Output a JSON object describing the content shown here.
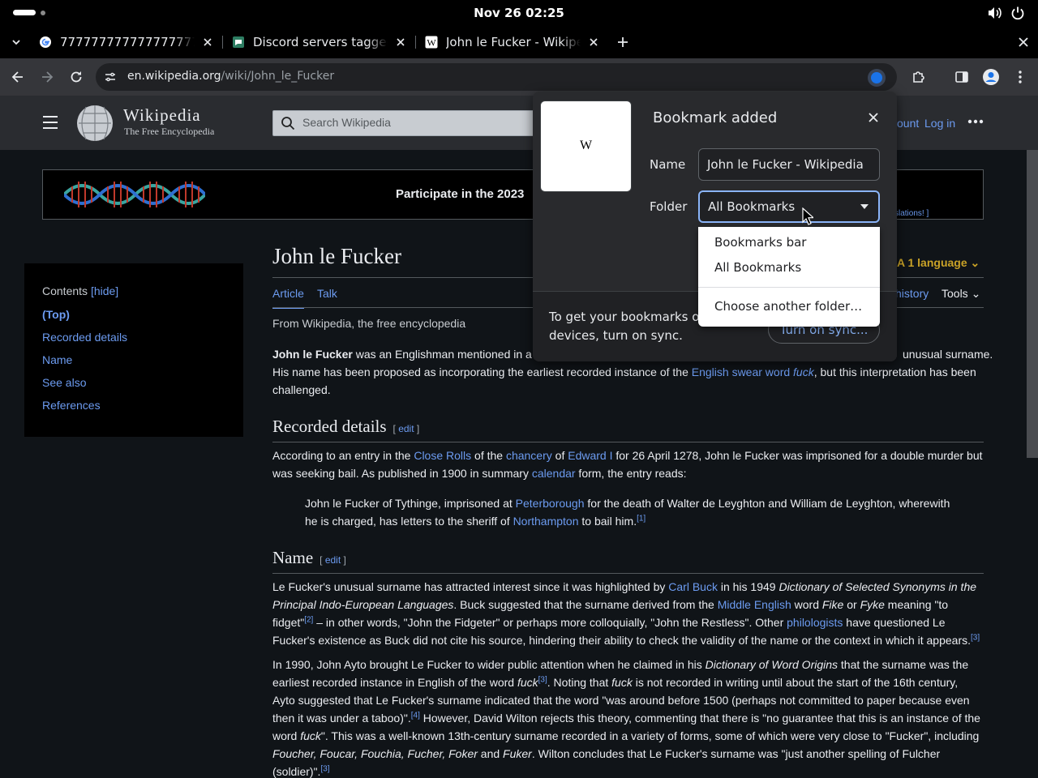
{
  "os": {
    "clock": "Nov 26  02:25",
    "icons": [
      "volume-icon",
      "power-icon"
    ]
  },
  "tabs": [
    {
      "title": "7777777777777777777777",
      "favicon": "google-icon"
    },
    {
      "title": "Discord servers tagged with",
      "favicon": "discord-servers-icon"
    },
    {
      "title": "John le Fucker - Wikipedia",
      "favicon": "wikipedia-icon"
    }
  ],
  "toolbar": {
    "url_host": "en.wikipedia.org",
    "url_path": "/wiki/John_le_Fucker"
  },
  "wiki": {
    "wordmark": "Wikipedia",
    "tagline": "The Free Encyclopedia",
    "search_placeholder": "Search Wikipedia",
    "create_account": "ount",
    "login": "Log in",
    "banner_text": "Participate in the 2023",
    "banner_link": "slations! ]",
    "toc": {
      "title": "Contents",
      "hide": "[hide]",
      "items": [
        "(Top)",
        "Recorded details",
        "Name",
        "See also",
        "References"
      ]
    },
    "article": {
      "title": "John le Fucker",
      "language_btn": "1 language",
      "tab_article": "Article",
      "tab_talk": "Talk",
      "history": "history",
      "tools": "Tools",
      "from": "From Wikipedia, the free encyclopedia",
      "lead_1a": "John le Fucker",
      "lead_1b": " was an Englishman mentioned in a",
      "lead_1c": "unusual surname.",
      "lead_2a": "His name has been proposed as incorporating the earliest recorded instance of the ",
      "lead_2link": "English swear word",
      "lead_2b": "fuck",
      "lead_2c": ", but this interpretation has been",
      "lead_3": "challenged.",
      "sec1_title": "Recorded details",
      "edit": "edit",
      "sec1_p1a": "According to an entry in the ",
      "sec1_close_rolls": "Close Rolls",
      "sec1_p1b": " of the ",
      "sec1_chancery": "chancery",
      "sec1_p1c": " of ",
      "sec1_edward": "Edward I",
      "sec1_p1d": " for 26 April 1278, John le Fucker was imprisoned for a double murder but",
      "sec1_p2a": "was seeking bail. As published in 1900 in summary ",
      "sec1_calendar": "calendar",
      "sec1_p2b": " form, the entry reads:",
      "quote_1a": "John le Fucker of Tythinge, imprisoned at ",
      "quote_peterborough": "Peterborough",
      "quote_1b": " for the death of Walter de Leyghton and William de Leyghton, wherewith",
      "quote_2a": "he is charged, has letters to the sheriff of ",
      "quote_northampton": "Northampton",
      "quote_2b": " to bail him.",
      "ref1": "[1]",
      "sec2_title": "Name",
      "n1a": "Le Fucker's unusual surname has attracted interest since it was highlighted by ",
      "n1_carl": "Carl Buck",
      "n1b": " in his 1949 ",
      "n1_book": "Dictionary of Selected Synonyms in the",
      "n2_book": "Principal Indo-European Languages",
      "n2a": ". Buck suggested that the surname derived from the ",
      "n2_middle": "Middle English",
      "n2b": " word ",
      "n2_fike": "Fike",
      "n2c": " or ",
      "n2_fyke": "Fyke",
      "n2d": " meaning \"to",
      "n3a": "fidget\"",
      "ref2": "[2]",
      "n3b": " – in other words, \"John the Fidgeter\" or perhaps more colloquially, \"John the Restless\". Other ",
      "n3_phil": "philologists",
      "n3c": " have questioned Le",
      "n4": "Fucker's existence as Buck did not cite his source, hindering their ability to check the validity of the name or the context in which it appears.",
      "ref3": "[3]",
      "a1a": "In 1990, John Ayto brought Le Fucker to wider public attention when he claimed in his ",
      "a1_book": "Dictionary of Word Origins",
      "a1b": " that the surname was the",
      "a2a": "earliest recorded instance in English of the word ",
      "a2_fuck": "fuck",
      "a2b": ". Noting that ",
      "a2c": " is not recorded in writing until about the start of the 16th century,",
      "a3": "Ayto suggested that Le Fucker's surname indicated that the word \"was around before 1500 (perhaps not committed to paper because even",
      "a4a": "then it was under a taboo)\".",
      "ref4": "[4]",
      "a4b": " However, David Wilton rejects this theory, commenting that there is \"no guarantee that this is an instance of the",
      "a5a": "word ",
      "a5b": "\". This was a well-known 13th-century surname recorded in a variety of forms, some of which were very close to \"Fucker\", including",
      "a6_forms": "Foucher, Foucar, Fouchia, Fucher, Foker",
      "a6_and": " and ",
      "a6_fuker": "Fuker",
      "a6b": ". Wilton concludes that Le Fucker's surname was \"just another spelling of Fulcher",
      "a7": "(soldier)\"."
    }
  },
  "bookmark_popup": {
    "title": "Bookmark added",
    "thumb_letter": "W",
    "name_label": "Name",
    "name_value": "John le Fucker - Wikipedia",
    "folder_label": "Folder",
    "folder_value": "All Bookmarks",
    "sync_text": "To get your bookmarks on all your devices, turn on sync.",
    "sync_button": "Turn on sync...",
    "dropdown_options": [
      "Bookmarks bar",
      "All Bookmarks",
      "Choose another folder…"
    ]
  },
  "colors": {
    "link": "#6c9bf0",
    "accent": "#8ab4f8",
    "popup_bg": "#292a2d",
    "page_bg": "#101418"
  }
}
